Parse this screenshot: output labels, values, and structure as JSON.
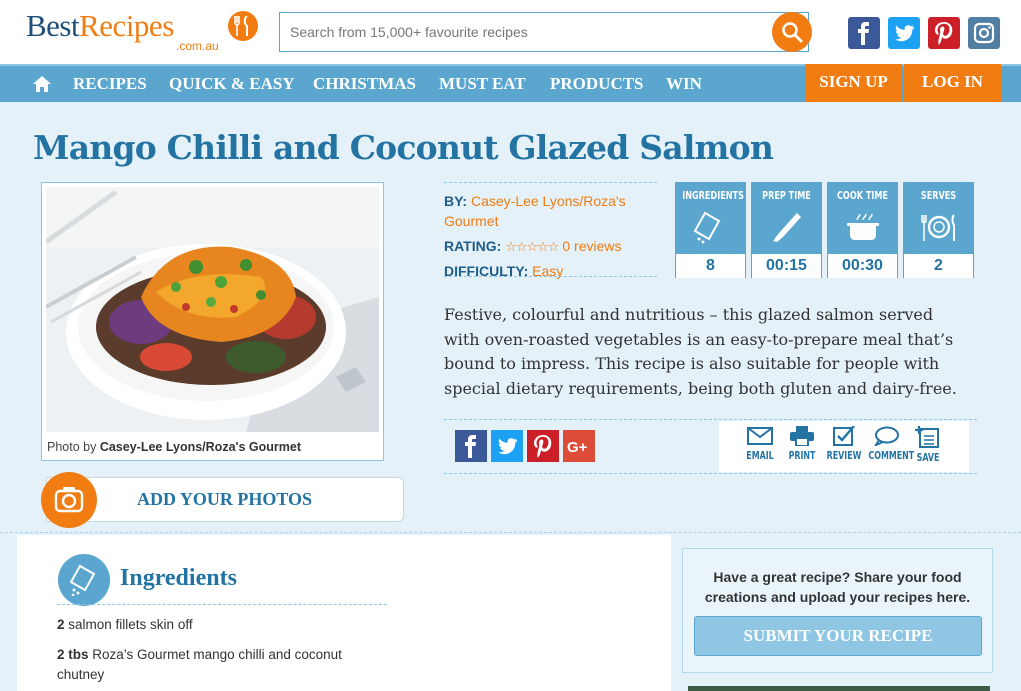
{
  "header": {
    "logo_best": "Best",
    "logo_recipes": "Recipes",
    "logo_domain": ".com.au",
    "search_placeholder": "Search from 15,000+ favourite recipes",
    "social": [
      "facebook-icon",
      "twitter-icon",
      "pinterest-icon",
      "instagram-icon"
    ]
  },
  "nav": {
    "items": [
      "RECIPES",
      "QUICK & EASY",
      "CHRISTMAS",
      "MUST EAT",
      "PRODUCTS",
      "WIN"
    ],
    "sign_up": "SIGN UP",
    "log_in": "LOG IN"
  },
  "recipe": {
    "title": "Mango Chilli and Coconut Glazed Salmon",
    "photo_credit_prefix": "Photo by",
    "photo_credit_name": "Casey-Lee Lyons/Roza's Gourmet",
    "add_photos": "ADD YOUR PHOTOS",
    "by_label": "BY:",
    "by_value_line1": "Casey-Lee Lyons/Roza's",
    "by_value_line2": "Gourmet",
    "rating_label": "RATING:",
    "rating_stars": "☆☆☆☆☆",
    "rating_value": 0,
    "rating_reviews": "0 reviews",
    "difficulty_label": "DIFFICULTY:",
    "difficulty_value": "Easy",
    "stats": [
      {
        "label": "INGREDIENTS",
        "value": "8",
        "icon": "salt-shaker-icon"
      },
      {
        "label": "PREP TIME",
        "value": "00:15",
        "icon": "knife-icon"
      },
      {
        "label": "COOK TIME",
        "value": "00:30",
        "icon": "pot-icon"
      },
      {
        "label": "SERVES",
        "value": "2",
        "icon": "plate-icon"
      }
    ],
    "description": "Festive, colourful and nutritious – this glazed salmon served with oven-roasted vegetables is an easy-to-prepare meal that’s bound to impress. This recipe is also suitable for people with special dietary requirements, being both gluten and dairy-free.",
    "share": [
      "facebook-icon",
      "twitter-icon",
      "pinterest-icon",
      "google-plus-icon"
    ],
    "actions": [
      "EMAIL",
      "PRINT",
      "REVIEW",
      "COMMENT",
      "SAVE"
    ]
  },
  "ingredients": {
    "title": "Ingredients",
    "items": [
      {
        "qty": "2",
        "text": "salmon fillets skin off"
      },
      {
        "qty": "2 tbs",
        "text": "Roza’s Gourmet mango chilli and coconut chutney"
      }
    ]
  },
  "sidebar": {
    "share_text": "Have a great recipe? Share your food creations and upload your recipes here.",
    "submit_label": "SUBMIT YOUR RECIPE"
  },
  "colors": {
    "brand_orange": "#f07c12",
    "brand_blue": "#5aa6cf",
    "title_blue": "#2373a3",
    "page_bg": "#e4f1f8"
  }
}
